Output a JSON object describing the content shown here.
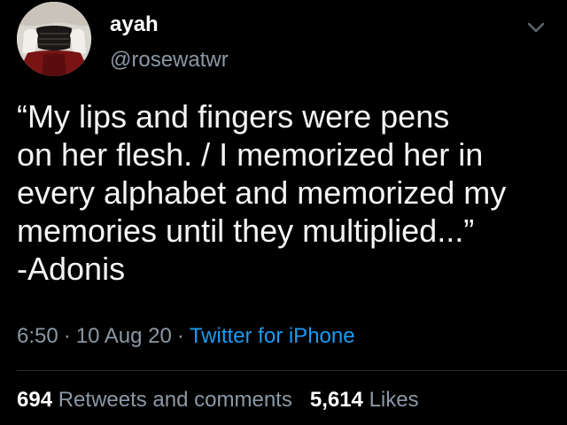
{
  "user": {
    "display_name": "ayah",
    "handle": "@rosewatwr",
    "avatar_icon": "profile-photo"
  },
  "header": {
    "menu_icon": "chevron-down-icon"
  },
  "tweet": {
    "lines": [
      "“My lips and fingers were pens",
      "on her flesh. /  I memorized her in",
      "every alphabet and memorized my",
      "memories until they multiplied...”",
      "-Adonis"
    ]
  },
  "meta": {
    "time": "6:50",
    "separator": "·",
    "date": "10 Aug 20",
    "source": "Twitter for iPhone"
  },
  "stats": {
    "retweets_count": "694",
    "retweets_label": "Retweets and comments",
    "likes_count": "5,614",
    "likes_label": "Likes"
  },
  "colors": {
    "background": "#000000",
    "text": "#ffffff",
    "secondary": "#8b98a5",
    "accent": "#1d9bf0"
  }
}
